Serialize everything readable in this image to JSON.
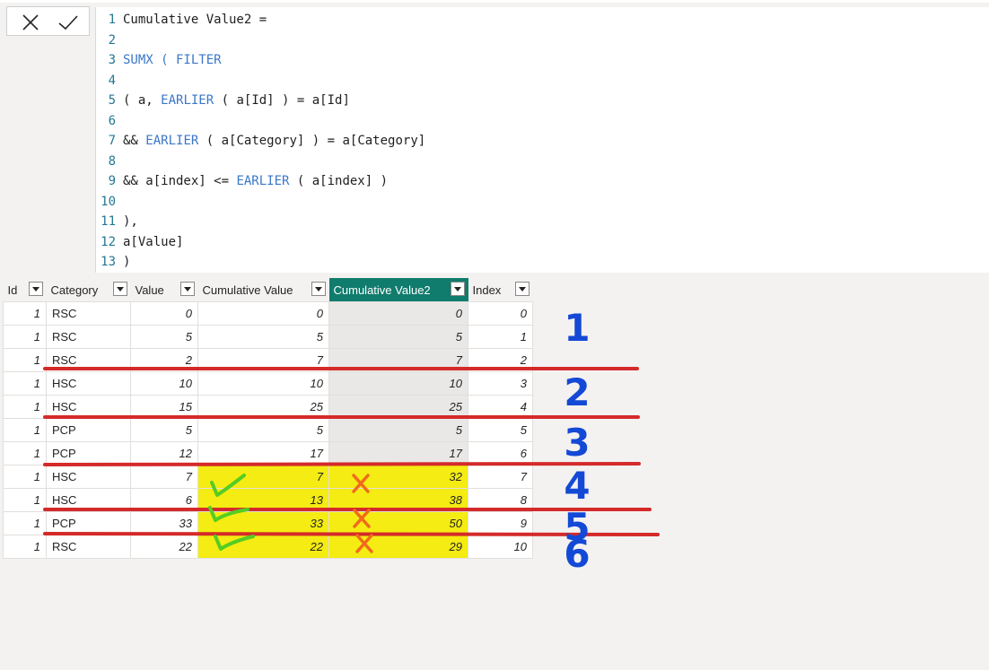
{
  "formula": {
    "lines": [
      {
        "num": "1",
        "parts": [
          {
            "t": "Cumulative Value2 =",
            "k": false
          }
        ]
      },
      {
        "num": "2",
        "parts": []
      },
      {
        "num": "3",
        "parts": [
          {
            "t": "SUMX ( FILTER",
            "k": true
          }
        ]
      },
      {
        "num": "4",
        "parts": []
      },
      {
        "num": "5",
        "parts": [
          {
            "t": "( a, ",
            "k": false
          },
          {
            "t": "EARLIER",
            "k": true
          },
          {
            "t": " ( a[Id] ) = a[Id]",
            "k": false
          }
        ]
      },
      {
        "num": "6",
        "parts": []
      },
      {
        "num": "7",
        "parts": [
          {
            "t": "&& ",
            "k": false
          },
          {
            "t": "EARLIER",
            "k": true
          },
          {
            "t": " ( a[Category] ) = a[Category]",
            "k": false
          }
        ]
      },
      {
        "num": "8",
        "parts": []
      },
      {
        "num": "9",
        "parts": [
          {
            "t": "&& a[index] <= ",
            "k": false
          },
          {
            "t": "EARLIER",
            "k": true
          },
          {
            "t": " ( a[index] )",
            "k": false
          }
        ]
      },
      {
        "num": "10",
        "parts": []
      },
      {
        "num": "11",
        "parts": [
          {
            "t": "),",
            "k": false
          }
        ]
      },
      {
        "num": "12",
        "parts": [
          {
            "t": "a[Value]",
            "k": false
          }
        ]
      },
      {
        "num": "13",
        "parts": [
          {
            "t": ")",
            "k": false
          }
        ]
      }
    ]
  },
  "table": {
    "columns": [
      "Id",
      "Category",
      "Value",
      "Cumulative Value",
      "Cumulative Value2",
      "Index"
    ],
    "selected_column": "Cumulative Value2",
    "rows": [
      [
        "1",
        "RSC",
        "0",
        "0",
        "0",
        "0"
      ],
      [
        "1",
        "RSC",
        "5",
        "5",
        "5",
        "1"
      ],
      [
        "1",
        "RSC",
        "2",
        "7",
        "7",
        "2"
      ],
      [
        "1",
        "HSC",
        "10",
        "10",
        "10",
        "3"
      ],
      [
        "1",
        "HSC",
        "15",
        "25",
        "25",
        "4"
      ],
      [
        "1",
        "PCP",
        "5",
        "5",
        "5",
        "5"
      ],
      [
        "1",
        "PCP",
        "12",
        "17",
        "17",
        "6"
      ],
      [
        "1",
        "HSC",
        "7",
        "7",
        "32",
        "7"
      ],
      [
        "1",
        "HSC",
        "6",
        "13",
        "38",
        "8"
      ],
      [
        "1",
        "PCP",
        "33",
        "33",
        "50",
        "9"
      ],
      [
        "1",
        "RSC",
        "22",
        "22",
        "29",
        "10"
      ]
    ],
    "highlighted_rows": [
      7,
      8,
      9,
      10
    ]
  },
  "annotations": {
    "group_numbers": [
      "1",
      "2",
      "3",
      "4",
      "5",
      "6"
    ],
    "checkmark_rows": [
      7,
      8,
      9,
      10
    ],
    "cross_rows": [
      7,
      9,
      10
    ],
    "colors": {
      "divider_line": "#d42a2a",
      "handwriting_blue": "#1449d6",
      "check_green": "#55cc22",
      "cross_orange": "#f26a1b",
      "highlight_yellow": "#f4ec12",
      "selected_header": "#107c6d"
    }
  },
  "icons": {
    "cancel": "close-icon",
    "commit": "check-icon",
    "column_filter": "filter-dropdown-icon"
  }
}
